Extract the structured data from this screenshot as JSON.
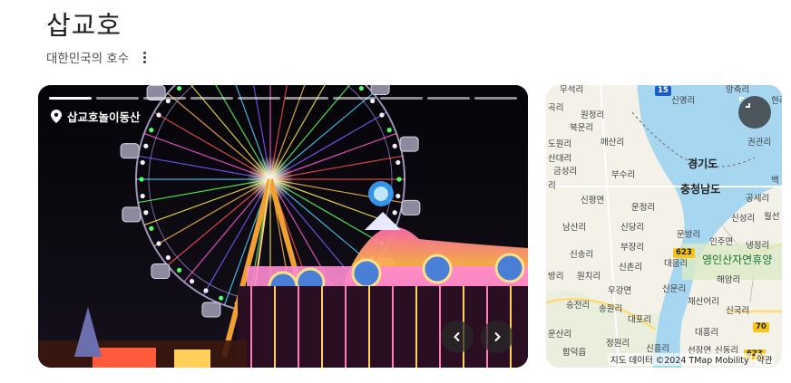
{
  "header": {
    "title": "삽교호",
    "subtitle": "대한민국의 호수"
  },
  "photo": {
    "location_label": "삽교호놀이동산",
    "segments_total": 10,
    "segments_active": 1
  },
  "map": {
    "attribution": "지도 데이터 ©2024 TMap Mobility",
    "terms_label": "약관",
    "province_labels": [
      "경기도",
      "충청남도"
    ],
    "poi_label": "영인산자연휴양",
    "road_badges": [
      "15",
      "623",
      "70",
      "623"
    ],
    "place_labels": [
      "무석리",
      "신영리",
      "망축리",
      "현리",
      "곡리",
      "원정리",
      "북운리",
      "매산리",
      "도원리",
      "산대리",
      "금성리",
      "권관리",
      "부수리",
      "백",
      "리",
      "공세리",
      "신평면",
      "운정리",
      "신성리",
      "월선",
      "남산리",
      "신당리",
      "문방리",
      "인주면",
      "냉정리",
      "신송리",
      "부장리",
      "대음리",
      "방리",
      "원치리",
      "신촌리",
      "해암리",
      "우강면",
      "신문리",
      "승전리",
      "송원리",
      "채산어리",
      "신국리",
      "대포리",
      "운산리",
      "정원리",
      "대흥리",
      "합덕읍",
      "신흥리",
      "선장면",
      "신동리"
    ]
  }
}
